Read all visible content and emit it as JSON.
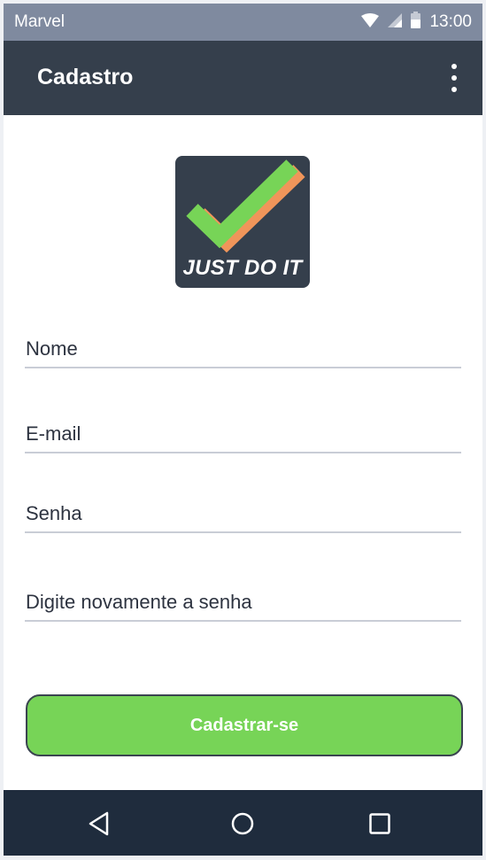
{
  "status_bar": {
    "carrier": "Marvel",
    "time": "13:00",
    "icons": [
      "wifi-icon",
      "signal-icon",
      "battery-icon"
    ]
  },
  "app_bar": {
    "title": "Cadastro",
    "menu_icon": "more-vert-icon"
  },
  "logo": {
    "text": "JUST DO IT",
    "icon": "checkmark-icon",
    "colors": {
      "background": "#353f4c",
      "check": "#77d457",
      "shadow": "#f0955a"
    }
  },
  "form": {
    "name_placeholder": "Nome",
    "email_placeholder": "E-mail",
    "password_placeholder": "Senha",
    "confirm_placeholder": "Digite novamente a senha",
    "submit_label": "Cadastrar-se"
  },
  "nav_bar": {
    "icons": [
      "back-icon",
      "home-icon",
      "recents-icon"
    ]
  },
  "colors": {
    "status_bar": "#7f8a9f",
    "app_bar": "#353f4c",
    "accent": "#77d457",
    "nav_bar": "#1f2c3d"
  }
}
